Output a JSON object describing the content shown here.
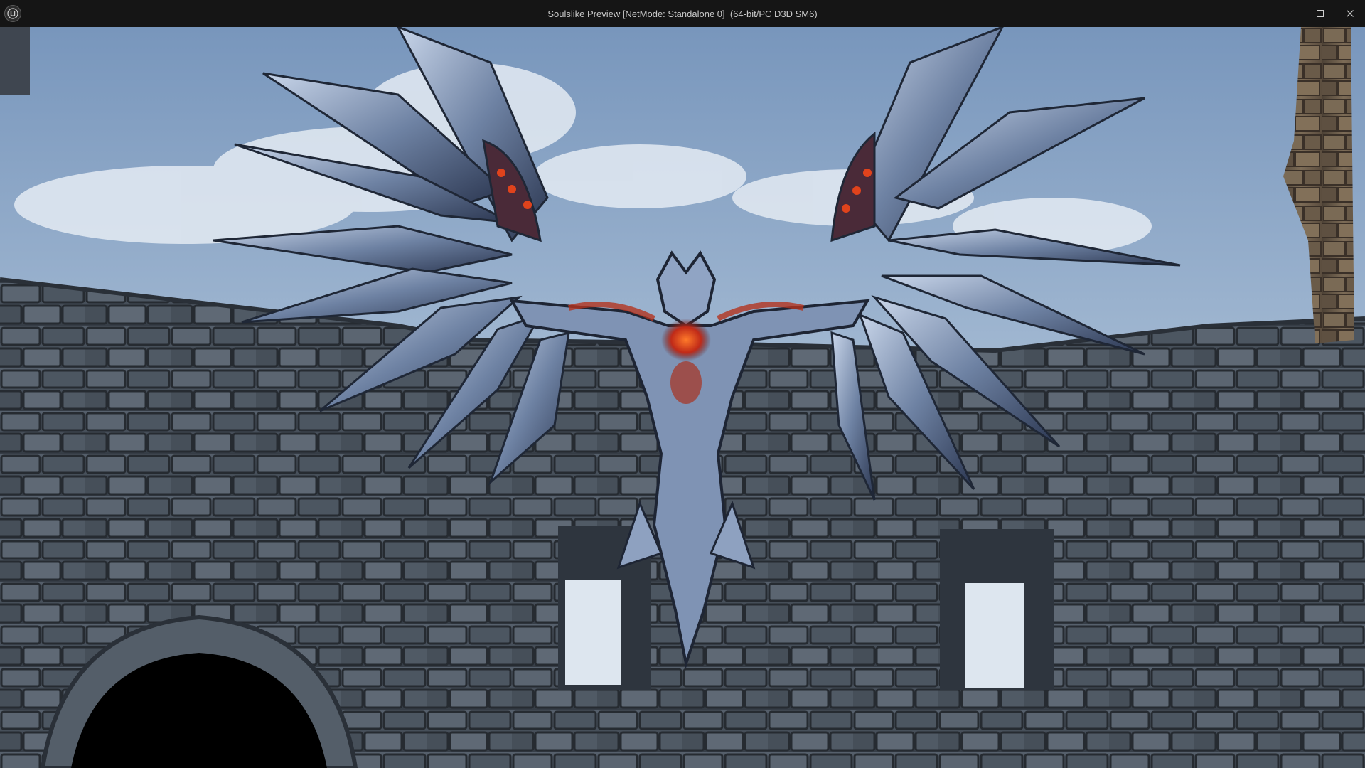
{
  "window": {
    "title": "Soulslike Preview [NetMode: Standalone 0]  (64-bit/PC D3D SM6)",
    "app_icon": "unreal-engine-logo-icon",
    "controls": [
      {
        "name": "minimize-button",
        "icon": "minimize-icon"
      },
      {
        "name": "maximize-button",
        "icon": "maximize-icon"
      },
      {
        "name": "close-button",
        "icon": "close-icon"
      }
    ]
  },
  "scene": {
    "description_colors": {
      "sky_top": "#7f9ec2",
      "sky_bottom": "#c2d2e3",
      "wall": "#4a5460",
      "wall_dark": "#2b3139",
      "creature_body": "#8fa4c4",
      "creature_glow": "#d43a1c",
      "tower_stone": "#6f5f4e"
    }
  }
}
